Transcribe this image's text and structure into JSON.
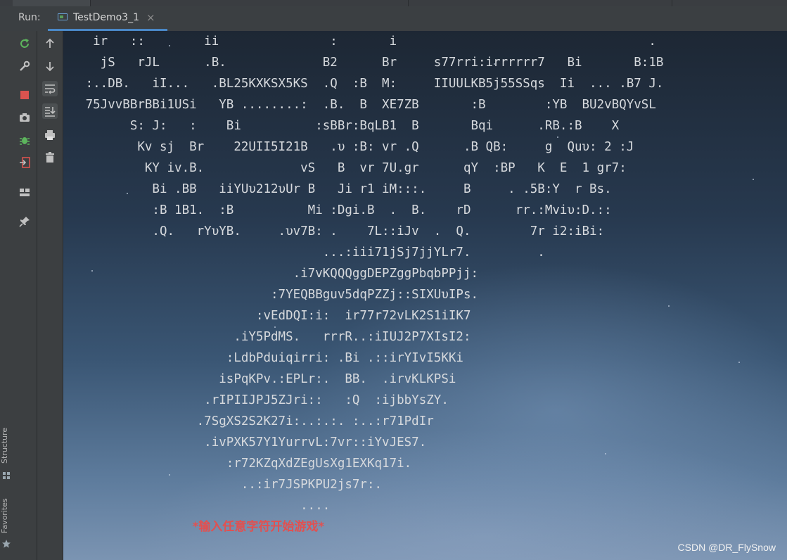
{
  "run_bar": {
    "label": "Run:",
    "tab_title": "TestDemo3_1",
    "tab_close": "×"
  },
  "left_strip": {
    "structure_label": "Structure",
    "favorites_label": "Favorites"
  },
  "toolbar_icons": {
    "column1": [
      "rerun-icon",
      "wrench-icon",
      "stop-icon",
      "camera-icon",
      "debug-bug-icon",
      "exit-icon",
      "layout-icon",
      "pin-icon"
    ],
    "column2": [
      "up-arrow-icon",
      "down-arrow-icon",
      "soft-wrap-icon",
      "scroll-to-end-icon",
      "print-icon",
      "trash-icon"
    ]
  },
  "console": {
    "lines": [
      "    ir   ::        ii               :       i                                  .",
      "     jS   rJL      .B.             B2      Br     s77rri:irrrrrr7   Bi       B:1B",
      "   :..DB.   iI...   .BL25KXKSX5KS  .Q  :B  M:     IIUULKB5j55SSqs  Ii  ... .B7 J.",
      "   75JvvBBrBBi1USi   YB ........:  .B.  B  XE7ZB       :B        :YB  BU2vBQYvSL",
      "         S: J:   :    Bi          :sBBr:BqLB1  B       Bqi      .RB.:B    X",
      "          Kv sj  Br    22UII5I21B   .υ :B: vr .Q      .B QB:     g  Quυ: 2 :J",
      "           KY iv.B.             vS   B  vr 7U.gr      qY  :BP   K  E  1 gr7:",
      "            Bi .BB   iiYUυ212υUr B   Ji r1 iM:::.     B     . .5B:Y  r Bs.",
      "            :B 1B1.  :B          Mi :Dgi.B  .  B.    rD      rr.:Mviυ:D.::",
      "            .Q.   rYυYB.     .υv7B: .    7L::iJv  .  Q.        7r i2:iBi:",
      "                                   ...:iii71jSj7jjYLr7.         .",
      "                               .i7vKQQQggDEPZggPbqbPPjj:",
      "                            :7YEQBBguv5dqPZZj::SIXUυIPs.",
      "                          :vEdDQI:i:  ir77r72vLK2S1iIK7",
      "                       .iY5PdMS.   rrrR..:iIUJ2P7XIsI2:",
      "                      :LdbPduiqirri: .Bi .::irYIvI5KKi",
      "                     isPqKPv.:EPLr:.  BB.  .irvKLKPSi",
      "                   .rIPIIJPJ5ZJri::   :Q  :ijbbYsZY.",
      "                  .7SgXS2S2K27i:..:.:. :..:r71PdIr",
      "                   .ivPXK57Y1YurrvL:7vr::iYvJES7.",
      "                      :r72KZqXdZEgUsXg1EXKq17i.",
      "                        ..:ir7JSPKPU2js7r:.",
      "                                ....",
      "                               *输入任意字符开始游戏*"
    ]
  },
  "watermark": "CSDN @DR_FlySnow",
  "colors": {
    "prompt": "#e25050",
    "console_text": "#d6d9dd",
    "rerun_green": "#5db55d",
    "stop_red": "#d9534f",
    "tab_underline": "#4a88c7"
  }
}
